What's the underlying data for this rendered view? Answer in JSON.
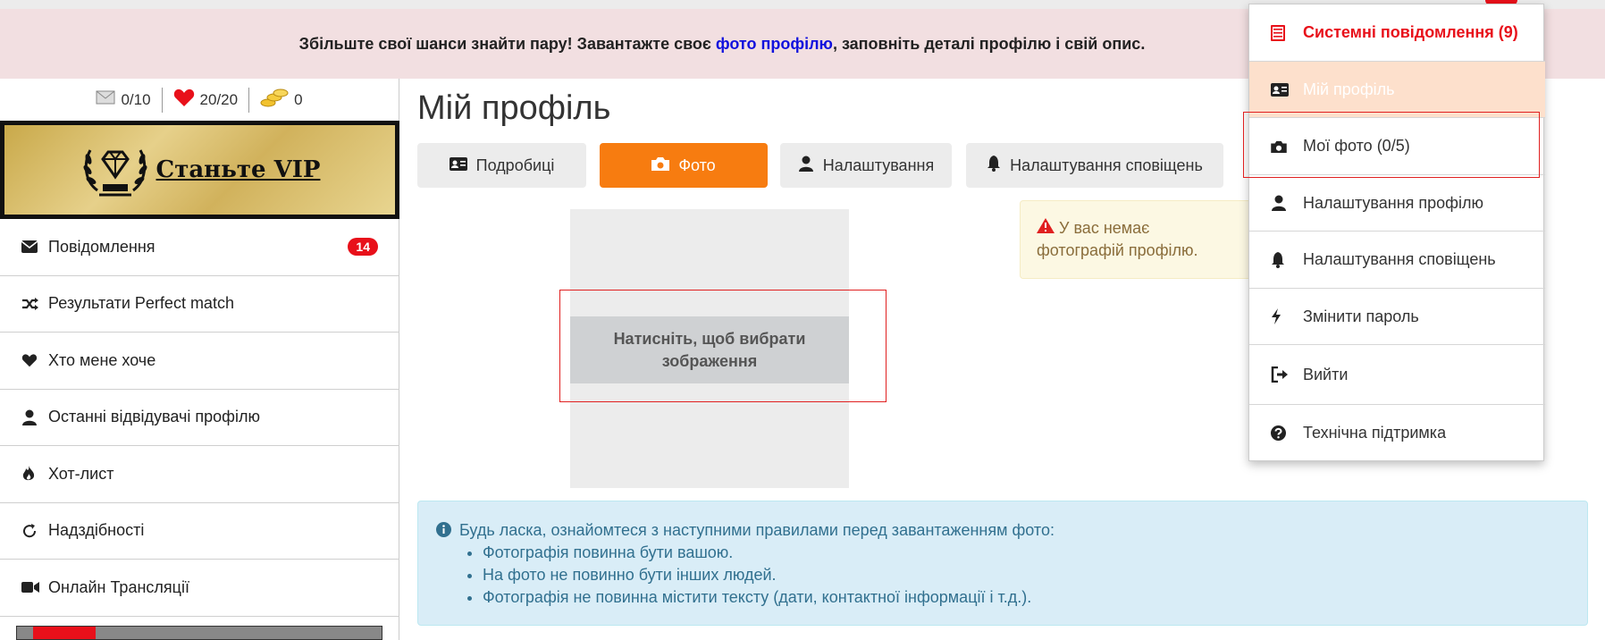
{
  "banner": {
    "text_before": "Збільште свої шанси знайти пару! Завантажте своє ",
    "link": "фото профілю",
    "text_after": ", заповніть деталі профілю і свій опис."
  },
  "stats": {
    "messages": "0/10",
    "likes": "20/20",
    "coins": "0"
  },
  "vip": {
    "label": "Станьте VIP"
  },
  "sidebar": {
    "items": [
      {
        "label": "Повідомлення",
        "icon": "envelope-icon",
        "badge": "14"
      },
      {
        "label": "Результати Perfect match",
        "icon": "shuffle-icon"
      },
      {
        "label": "Хто мене хоче",
        "icon": "heart-icon"
      },
      {
        "label": "Останні відвідувачі профілю",
        "icon": "user-icon"
      },
      {
        "label": "Хот-лист",
        "icon": "fire-icon"
      },
      {
        "label": "Надздібності",
        "icon": "refresh-icon"
      },
      {
        "label": "Онлайн Трансляції",
        "icon": "video-icon"
      }
    ]
  },
  "main": {
    "title": "Мій профіль",
    "tabs": [
      {
        "label": "Подробиці",
        "icon": "id-card-icon",
        "active": false
      },
      {
        "label": "Фото",
        "icon": "camera-icon",
        "active": true
      },
      {
        "label": "Налаштування",
        "icon": "user-icon",
        "active": false
      },
      {
        "label": "Налаштування сповіщень",
        "icon": "bell-icon",
        "active": false
      }
    ],
    "photo_select": "Натисніть, щоб вибрати зображення",
    "warning": "У вас немає фотографій профілю.",
    "info": {
      "heading": "Будь ласка, ознайомтеся з наступними правилами перед завантаженням фото:",
      "rules": [
        "Фотографія повинна бути вашою.",
        "На фото не повинно бути інших людей.",
        "Фотографія не повинна містити тексту (дати, контактної інформації і т.д.)."
      ]
    }
  },
  "dropdown": {
    "items": [
      {
        "label": "Системні повідомлення (9)",
        "icon": "list-icon"
      },
      {
        "label": "Мій профіль",
        "icon": "id-card-icon"
      },
      {
        "label": "Мої фото (0/5)",
        "icon": "camera-icon"
      },
      {
        "label": "Налаштування профілю",
        "icon": "user-icon"
      },
      {
        "label": "Налаштування сповіщень",
        "icon": "bell-icon"
      },
      {
        "label": "Змінити пароль",
        "icon": "bolt-icon"
      },
      {
        "label": "Вийти",
        "icon": "sign-out-icon"
      },
      {
        "label": "Технічна підтримка",
        "icon": "question-icon"
      }
    ]
  },
  "colors": {
    "accent": "#f77c10",
    "danger": "#e8101a",
    "banner_bg": "#f2dfe1",
    "info_bg": "#d9edf7",
    "warning_bg": "#fcf8e3"
  }
}
